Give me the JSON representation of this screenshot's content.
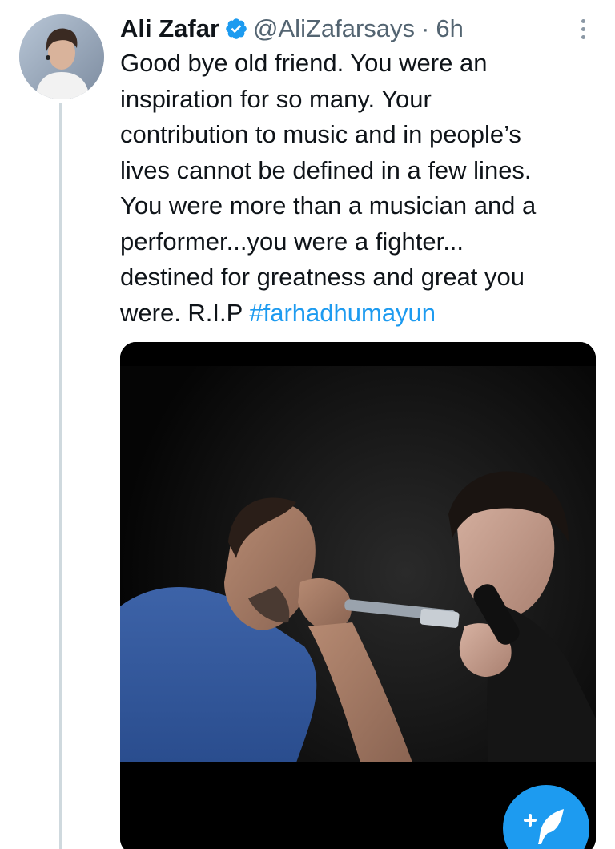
{
  "tweet": {
    "author": {
      "name": "Ali Zafar",
      "handle": "@AliZafarsays",
      "separator": "·",
      "time": "6h",
      "verified": true
    },
    "text_lines": [
      "Good bye old friend. You were an",
      "inspiration for so many. Your",
      "contribution to music and in people’s",
      "lives cannot be defined in a few lines.",
      "You were more than a musician and a",
      "performer...you were a fighter...",
      "destined for greatness and great you"
    ],
    "last_line_prefix": "were. R.I.P ",
    "hashtag": "#farhadhumayun",
    "media": {
      "kind": "photo",
      "content": "two singers performing with microphones on a dark stage"
    }
  },
  "icons": {
    "verified": "verified-badge-icon",
    "more": "more-options-icon",
    "compose": "compose-tweet-icon"
  },
  "colors": {
    "text": "#0f1419",
    "secondary": "#536471",
    "link": "#1d9bf0",
    "verified": "#1d9bf0",
    "fab": "#1d9bf0",
    "thread_line": "#cfd9de"
  }
}
